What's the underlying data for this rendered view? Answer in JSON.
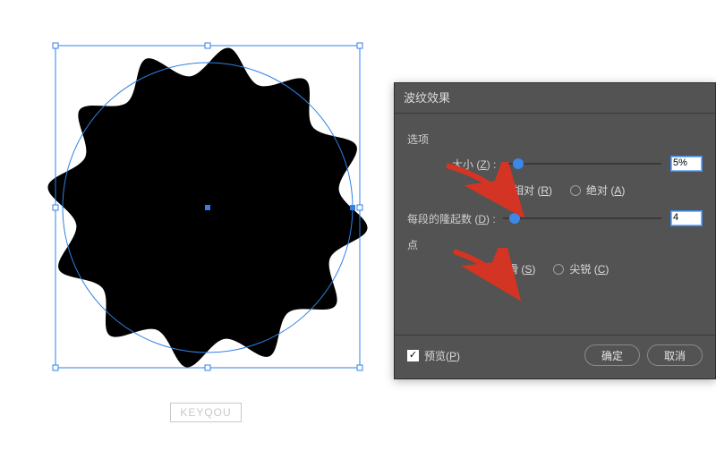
{
  "dialog": {
    "title": "波纹效果",
    "options_label": "选项",
    "size_label": "大小",
    "size_key": "Z",
    "size_value": "5%",
    "size_knob_pct": 6,
    "radio_relative_label": "相对",
    "radio_relative_key": "R",
    "radio_absolute_label": "绝对",
    "radio_absolute_key": "A",
    "size_mode_selected": "relative",
    "ridges_label": "每段的隆起数",
    "ridges_key": "D",
    "ridges_value": "4",
    "ridges_knob_pct": 4,
    "points_label": "点",
    "radio_smooth_label": "平滑",
    "radio_smooth_key": "S",
    "radio_sharp_label": "尖锐",
    "radio_sharp_key": "C",
    "points_selected": "smooth",
    "preview_label": "预览",
    "preview_key": "P",
    "preview_checked": true,
    "ok_label": "确定",
    "cancel_label": "取消"
  },
  "watermark": "KEYQOU",
  "colors": {
    "selection": "#2f80e8",
    "dialog_bg": "#535353",
    "arrow": "#d33423"
  }
}
